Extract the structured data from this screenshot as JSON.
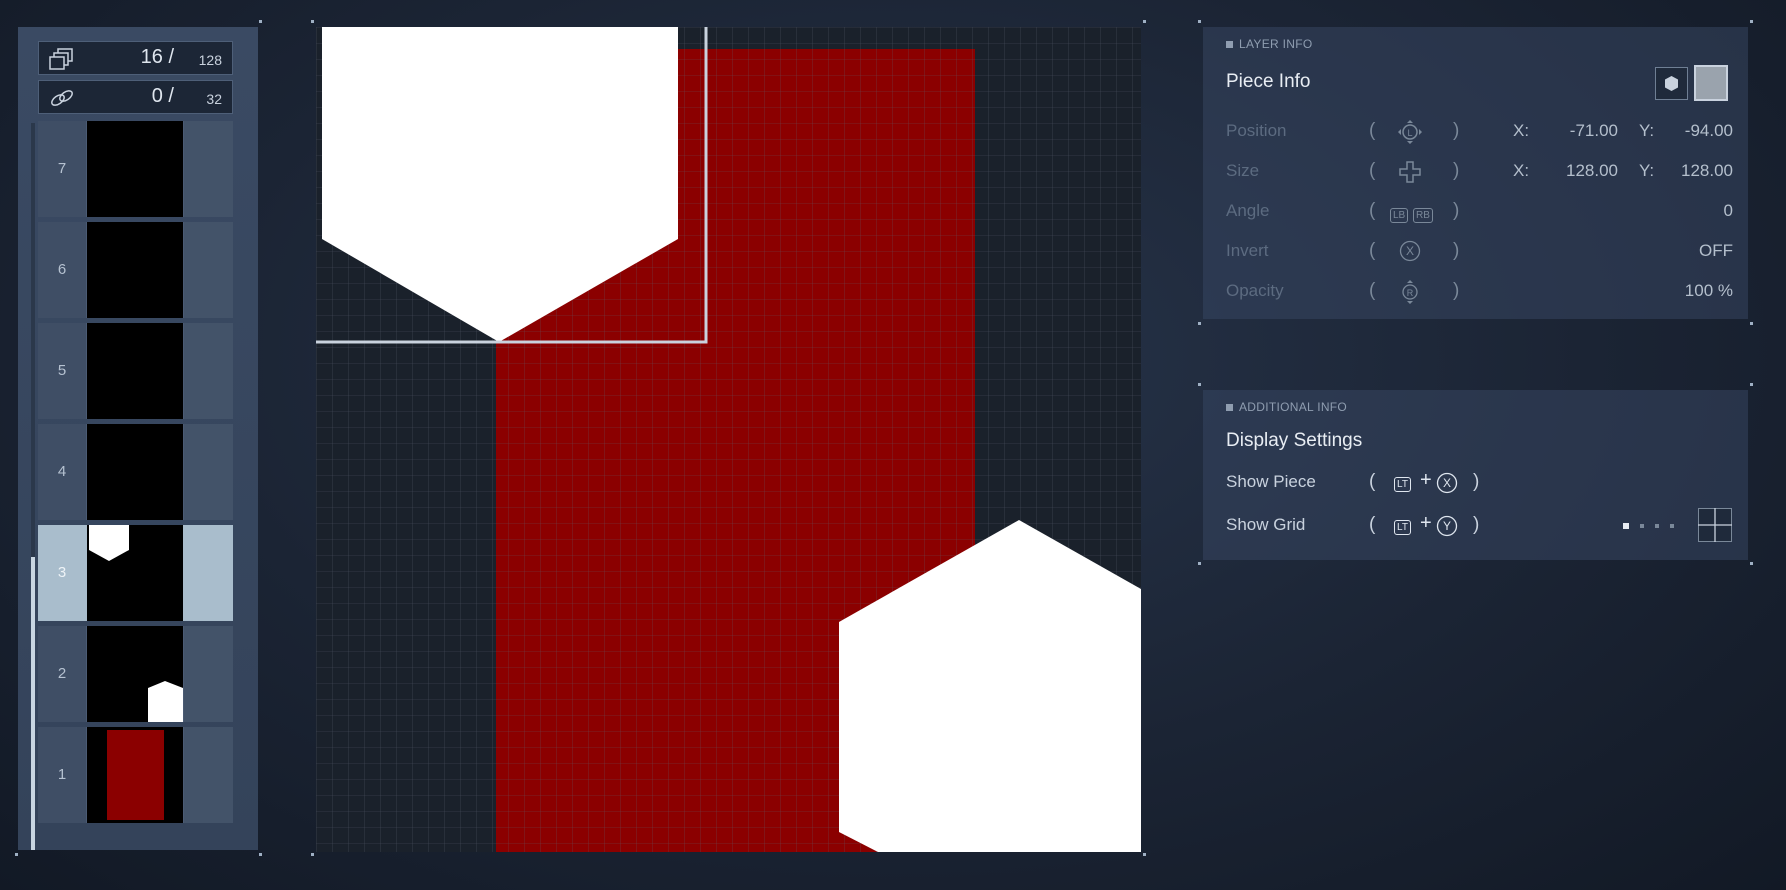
{
  "counters": {
    "pieces": {
      "value": "16 /",
      "max": "128",
      "icon": "layers-stack-icon"
    },
    "links": {
      "value": "0 /",
      "max": "32",
      "icon": "chain-link-icon"
    }
  },
  "layers": [
    {
      "number": "7",
      "selected": false
    },
    {
      "number": "6",
      "selected": false
    },
    {
      "number": "5",
      "selected": false
    },
    {
      "number": "4",
      "selected": false
    },
    {
      "number": "3",
      "selected": true
    },
    {
      "number": "2",
      "selected": false
    },
    {
      "number": "1",
      "selected": false
    }
  ],
  "canvas": {
    "colors": {
      "background": "#1a212b",
      "red": "#8b0000",
      "white": "#ffffff",
      "grid": "#5a6472"
    }
  },
  "layer_info": {
    "header": "LAYER INFO",
    "title": "Piece Info",
    "rows": {
      "position": {
        "label": "Position",
        "x_label": "X:",
        "x_value": "-71.00",
        "y_label": "Y:",
        "y_value": "-94.00",
        "button": "left-stick-icon"
      },
      "size": {
        "label": "Size",
        "x_label": "X:",
        "x_value": "128.00",
        "y_label": "Y:",
        "y_value": "128.00",
        "button": "dpad-icon"
      },
      "angle": {
        "label": "Angle",
        "value": "0",
        "lb": "LB",
        "rb": "RB"
      },
      "invert": {
        "label": "Invert",
        "value": "OFF",
        "button": "X"
      },
      "opacity": {
        "label": "Opacity",
        "value": "100 %",
        "button": "R"
      }
    }
  },
  "additional_info": {
    "header": "ADDITIONAL INFO",
    "title": "Display Settings",
    "show_piece": {
      "label": "Show Piece",
      "lt": "LT",
      "plus": "+",
      "button": "X"
    },
    "show_grid": {
      "label": "Show Grid",
      "lt": "LT",
      "plus": "+",
      "button": "Y"
    }
  }
}
